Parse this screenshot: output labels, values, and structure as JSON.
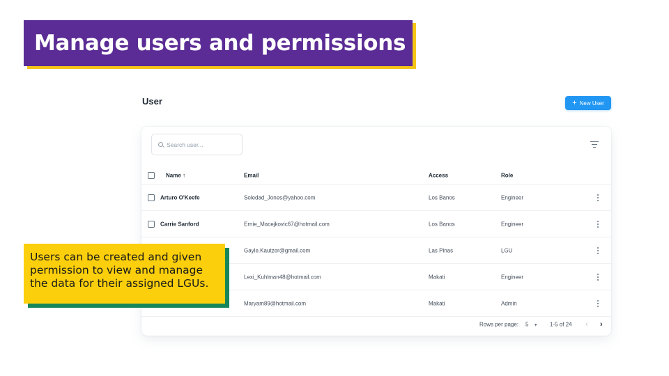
{
  "slide": {
    "title": "Manage users and permissions",
    "callout": "Users can be created and given permission to view and manage the data for their assigned LGUs."
  },
  "app": {
    "page_title": "User",
    "new_user_label": "New User",
    "search_placeholder": "Search user...",
    "columns": {
      "name": "Name ↑",
      "email": "Email",
      "access": "Access",
      "role": "Role"
    },
    "rows": [
      {
        "name": "Arturo O'Keefe",
        "email": "Soledad_Jones@yahoo.com",
        "access": "Los Banos",
        "role": "Engineer"
      },
      {
        "name": "Carrie Sanford",
        "email": "Ernie_Macejkovic67@hotmail.com",
        "access": "Los Banos",
        "role": "Engineer"
      },
      {
        "name": "",
        "email": "Gayle.Kautzer@gmail.com",
        "access": "Las Pinas",
        "role": "LGU"
      },
      {
        "name": "",
        "email": "Lexi_Kuhlman48@hotmail.com",
        "access": "Makati",
        "role": "Engineer"
      },
      {
        "name": "",
        "email": "Maryam89@hotmail.com",
        "access": "Makati",
        "role": "Admin"
      }
    ],
    "pagination": {
      "rows_per_page_label": "Rows per page:",
      "rows_per_page_value": "5",
      "range": "1-5 of 24"
    }
  },
  "colors": {
    "title_bg": "#5b2c95",
    "title_accent": "#f5c518",
    "callout_bg": "#fccf0c",
    "callout_accent": "#16865a",
    "primary_button": "#2196f3"
  },
  "icons": [
    "plus-icon",
    "search-icon",
    "filter-icon",
    "more-vertical-icon",
    "chevron-left-icon",
    "chevron-right-icon",
    "caret-down-icon"
  ]
}
